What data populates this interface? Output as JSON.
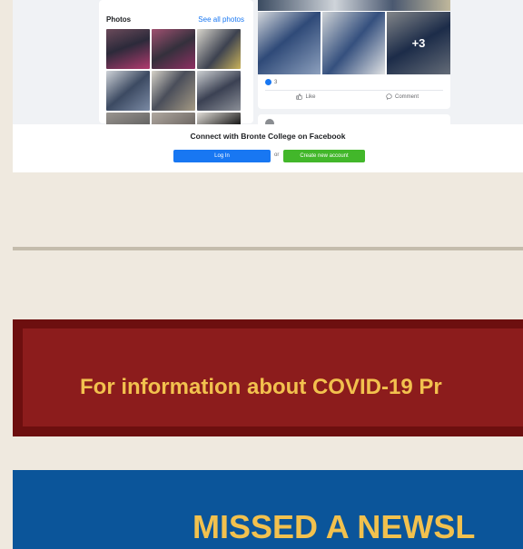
{
  "facebook_embed": {
    "photos": {
      "title": "Photos",
      "see_all": "See all photos"
    },
    "post": {
      "more_photos": "+3",
      "reaction_count": "3",
      "like_label": "Like",
      "comment_label": "Comment"
    },
    "connect": {
      "text": "Connect with Bronte College on Facebook",
      "login_label": "Log In",
      "or_label": "or",
      "create_label": "Create new account"
    },
    "colors": {
      "facebook_blue": "#1877f2",
      "create_green": "#42b72a"
    }
  },
  "covid_banner": {
    "text": "For information about COVID-19 Pr",
    "colors": {
      "outer": "#6d0f0f",
      "inner": "#8c1c1c",
      "text": "#f2c14e"
    }
  },
  "newsletter_banner": {
    "text": "MISSED A NEWSL",
    "colors": {
      "background": "#0b559a",
      "text": "#f2c14e"
    }
  }
}
